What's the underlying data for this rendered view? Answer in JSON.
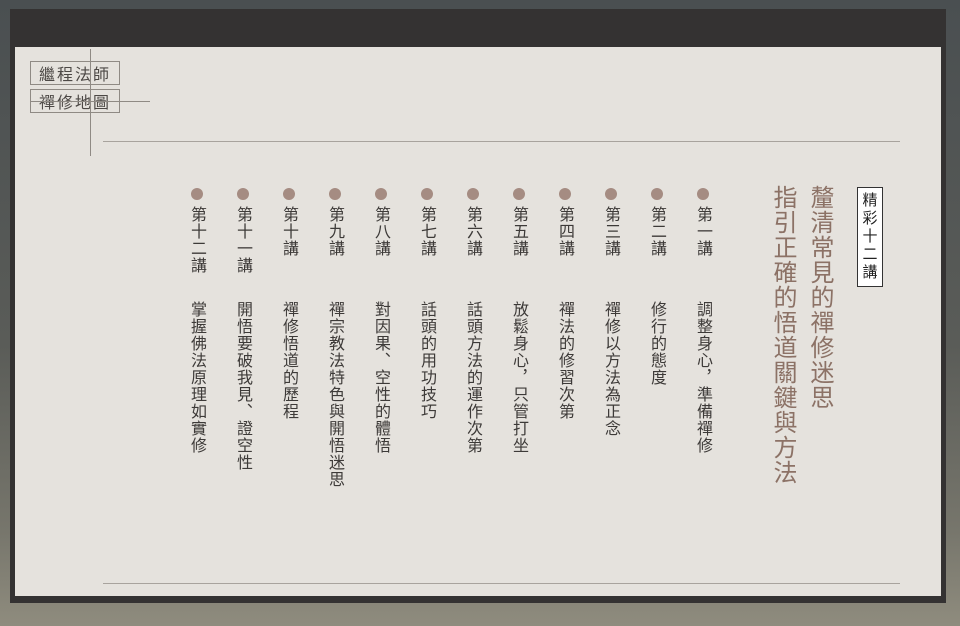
{
  "logo": {
    "line1": "繼程法師",
    "line2": "禪修地圖"
  },
  "badge": "精彩十二講",
  "headline": {
    "line1": "釐清常見的禪修迷思",
    "line2": "指引正確的悟道關鍵與方法"
  },
  "lectures": [
    {
      "num": "第一講",
      "title": "調整身心，準備禪修"
    },
    {
      "num": "第二講",
      "title": "修行的態度"
    },
    {
      "num": "第三講",
      "title": "禪修以方法為正念"
    },
    {
      "num": "第四講",
      "title": "禪法的修習次第"
    },
    {
      "num": "第五講",
      "title": "放鬆身心，只管打坐"
    },
    {
      "num": "第六講",
      "title": "話頭方法的運作次第"
    },
    {
      "num": "第七講",
      "title": "話頭的用功技巧"
    },
    {
      "num": "第八講",
      "title": "對因果、空性的體悟"
    },
    {
      "num": "第九講",
      "title": "禪宗教法特色與開悟迷思"
    },
    {
      "num": "第十講",
      "title": "禪修悟道的歷程"
    },
    {
      "num": "第十一講",
      "title": "開悟要破我見、證空性"
    },
    {
      "num": "第十二講",
      "title": "掌握佛法原理如實修"
    }
  ],
  "colors": {
    "accent": "#8c7266",
    "dot": "#a58c82",
    "card": "#e5e2dd",
    "frame": "#343232"
  }
}
